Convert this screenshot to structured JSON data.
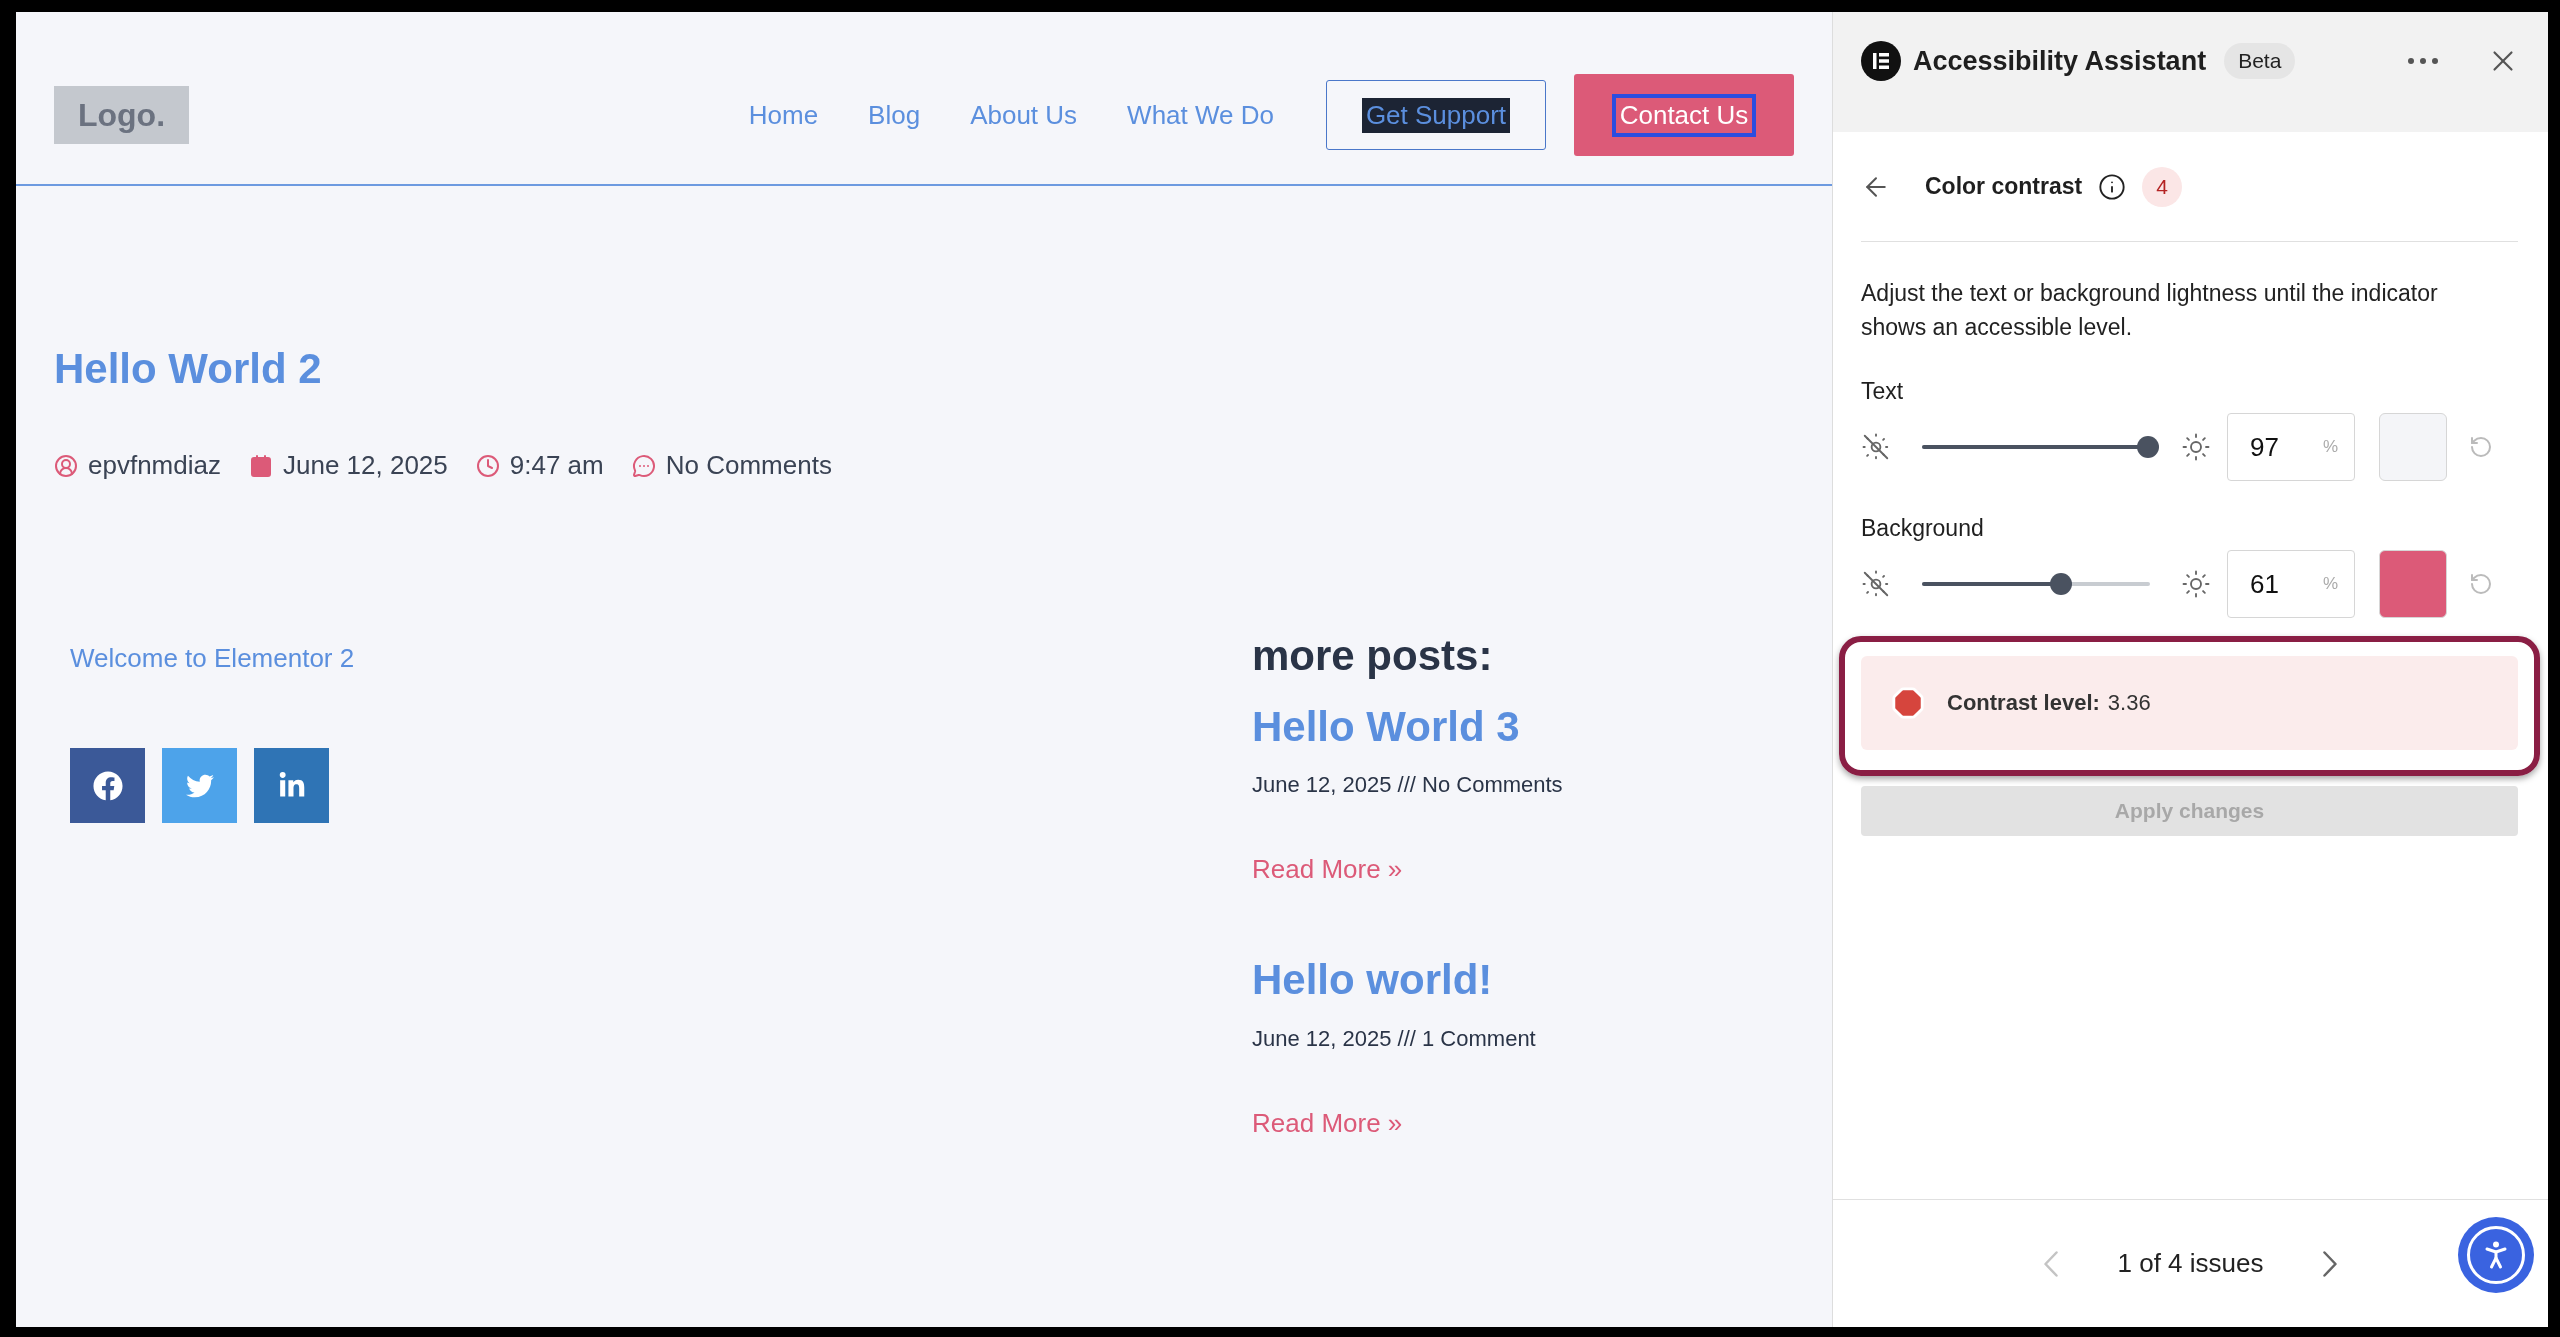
{
  "site": {
    "logo": "Logo.",
    "nav": [
      {
        "label": "Home"
      },
      {
        "label": "Blog"
      },
      {
        "label": "About Us"
      },
      {
        "label": "What We Do"
      }
    ],
    "buttons": [
      {
        "label": "Get Support",
        "kind": "outline",
        "text_selected": true,
        "focused": false
      },
      {
        "label": "Contact Us",
        "kind": "filled",
        "text_selected": false,
        "focused": true
      }
    ]
  },
  "post": {
    "title": "Hello World 2",
    "meta": [
      {
        "kind": "author",
        "text": "epvfnmdiaz"
      },
      {
        "kind": "date",
        "text": "June 12, 2025"
      },
      {
        "kind": "time",
        "text": "9:47 am"
      },
      {
        "kind": "comments",
        "text": "No Comments"
      }
    ],
    "body_link": "Welcome to Elementor 2",
    "share": [
      {
        "kind": "facebook"
      },
      {
        "kind": "twitter"
      },
      {
        "kind": "linkedin"
      }
    ]
  },
  "more_posts": {
    "heading": "more posts:",
    "posts": [
      {
        "title": "Hello World 3",
        "meta": "June 12, 2025 /// No Comments",
        "read_more": "Read More »"
      },
      {
        "title": "Hello world!",
        "meta": "June 12, 2025 /// 1 Comment",
        "read_more": "Read More »"
      }
    ]
  },
  "panel": {
    "title": "Accessibility Assistant",
    "badge": "Beta",
    "section": "Color contrast",
    "issue_count": "4",
    "description": "Adjust the text or background lightness until the indicator shows an accessible level.",
    "controls": [
      {
        "label": "Text",
        "level": 0.99,
        "value": "97",
        "unit": "%",
        "color": "#f4f5f8"
      },
      {
        "label": "Background",
        "level": 0.61,
        "value": "61",
        "unit": "%",
        "color": "#dc5a78"
      }
    ],
    "contrast": {
      "label": "Contrast level:",
      "value": "3.36",
      "failing": true,
      "highlighted": true
    },
    "apply": {
      "label": "Apply changes",
      "disabled": true
    },
    "pager": {
      "text": "1 of 4 issues",
      "prev_disabled": true,
      "next_disabled": false
    }
  }
}
